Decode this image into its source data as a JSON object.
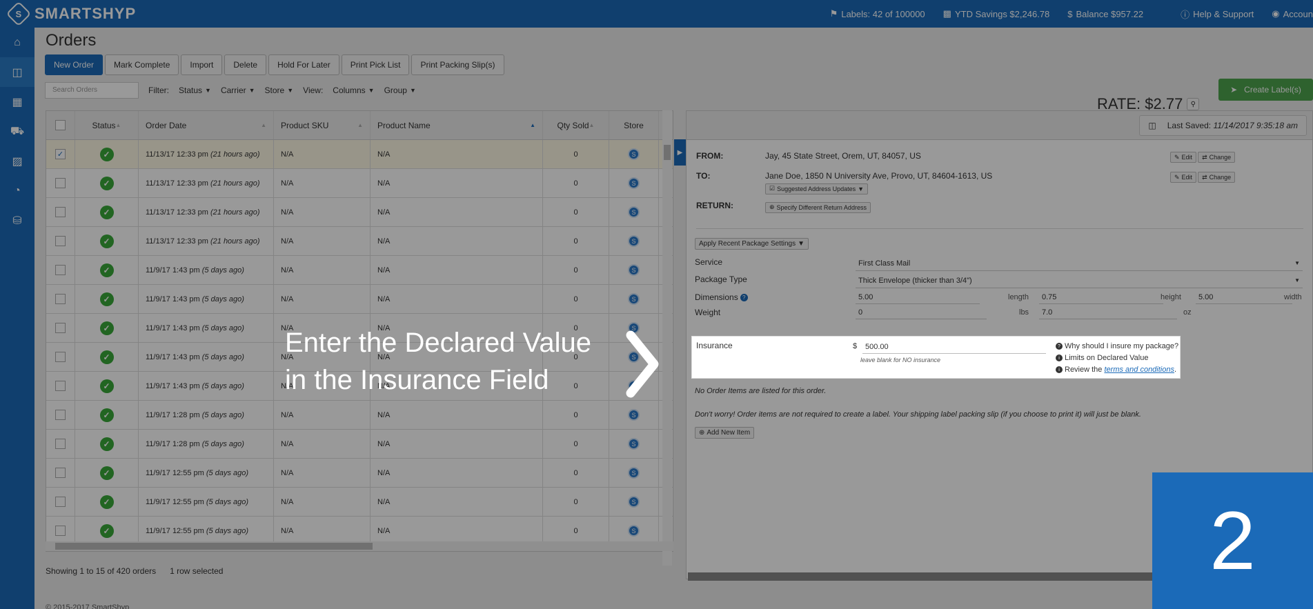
{
  "brand": {
    "logo_mark": "S",
    "name": "SMARTSHYP"
  },
  "topnav": {
    "labels": "Labels: 42 of 100000",
    "ytd": "YTD Savings $2,246.78",
    "balance": "Balance $957.22",
    "help": "Help & Support",
    "account": "Accoun"
  },
  "sidebar_icons": [
    "home-icon",
    "basket-icon",
    "calendar-icon",
    "truck-icon",
    "contacts-icon",
    "pie-chart-icon",
    "cart-icon"
  ],
  "page": {
    "title": "Orders"
  },
  "toolbar": {
    "new_order": "New Order",
    "mark_complete": "Mark Complete",
    "import": "Import",
    "delete": "Delete",
    "hold": "Hold For Later",
    "pick_list": "Print Pick List",
    "packing_slips": "Print Packing Slip(s)"
  },
  "filters": {
    "search_placeholder": "Search Orders",
    "filter_label": "Filter:",
    "status": "Status",
    "carrier": "Carrier",
    "store": "Store",
    "view_label": "View:",
    "columns": "Columns",
    "group": "Group"
  },
  "table": {
    "headers": [
      "Status",
      "Order Date",
      "Product SKU",
      "Product Name",
      "Qty Sold",
      "Store"
    ],
    "rows": [
      {
        "date": "11/13/17 12:33 pm",
        "ago": "(21 hours ago)",
        "sku": "N/A",
        "name": "N/A",
        "qty": "0"
      },
      {
        "date": "11/13/17 12:33 pm",
        "ago": "(21 hours ago)",
        "sku": "N/A",
        "name": "N/A",
        "qty": "0"
      },
      {
        "date": "11/13/17 12:33 pm",
        "ago": "(21 hours ago)",
        "sku": "N/A",
        "name": "N/A",
        "qty": "0"
      },
      {
        "date": "11/13/17 12:33 pm",
        "ago": "(21 hours ago)",
        "sku": "N/A",
        "name": "N/A",
        "qty": "0"
      },
      {
        "date": "11/9/17 1:43 pm",
        "ago": "(5 days ago)",
        "sku": "N/A",
        "name": "N/A",
        "qty": "0"
      },
      {
        "date": "11/9/17 1:43 pm",
        "ago": "(5 days ago)",
        "sku": "N/A",
        "name": "N/A",
        "qty": "0"
      },
      {
        "date": "11/9/17 1:43 pm",
        "ago": "(5 days ago)",
        "sku": "N/A",
        "name": "N/A",
        "qty": "0"
      },
      {
        "date": "11/9/17 1:43 pm",
        "ago": "(5 days ago)",
        "sku": "N/A",
        "name": "N/A",
        "qty": "0"
      },
      {
        "date": "11/9/17 1:43 pm",
        "ago": "(5 days ago)",
        "sku": "N/A",
        "name": "N/A",
        "qty": "0"
      },
      {
        "date": "11/9/17 1:28 pm",
        "ago": "(5 days ago)",
        "sku": "N/A",
        "name": "N/A",
        "qty": "0"
      },
      {
        "date": "11/9/17 1:28 pm",
        "ago": "(5 days ago)",
        "sku": "N/A",
        "name": "N/A",
        "qty": "0"
      },
      {
        "date": "11/9/17 12:55 pm",
        "ago": "(5 days ago)",
        "sku": "N/A",
        "name": "N/A",
        "qty": "0"
      },
      {
        "date": "11/9/17 12:55 pm",
        "ago": "(5 days ago)",
        "sku": "N/A",
        "name": "N/A",
        "qty": "0"
      },
      {
        "date": "11/9/17 12:55 pm",
        "ago": "(5 days ago)",
        "sku": "N/A",
        "name": "N/A",
        "qty": "0"
      }
    ],
    "footer_showing": "Showing 1 to 15 of 420 orders",
    "footer_selected": "1 row selected"
  },
  "copyright": "© 2015-2017 SmartShyp",
  "rate": {
    "label": "RATE: $2.77",
    "create_button": "Create Label(s)"
  },
  "panel": {
    "last_saved_label": "Last Saved:",
    "last_saved_value": "11/14/2017 9:35:18 am",
    "from_label": "FROM:",
    "from_value": "Jay, 45 State Street, Orem, UT, 84057, US",
    "to_label": "TO:",
    "to_value": "Jane Doe, 1850 N University Ave, Provo, UT, 84604-1613, US",
    "suggested": "Suggested Address Updates",
    "return_label": "RETURN:",
    "return_button": "Specify Different Return Address",
    "edit": "Edit",
    "change": "Change",
    "recent_pkg": "Apply Recent Package Settings",
    "service_label": "Service",
    "service_value": "First Class Mail",
    "package_label": "Package Type",
    "package_value": "Thick Envelope (thicker than 3/4\")",
    "dimensions_label": "Dimensions",
    "length": "5.00",
    "length_unit": "length",
    "height": "0.75",
    "height_unit": "height",
    "width": "5.00",
    "width_unit": "width",
    "weight_label": "Weight",
    "lbs": "0",
    "lbs_unit": "lbs",
    "oz": "7.0",
    "oz_unit": "oz",
    "insurance_label": "Insurance",
    "currency": "$",
    "insurance_value": "500.00",
    "insurance_hint": "leave blank for NO insurance",
    "why_insure": "Why should I insure my package?",
    "limits": "Limits on Declared Value",
    "review_prefix": "Review the",
    "terms": "terms and conditions",
    "review_suffix": ".",
    "no_items": "No Order Items are listed for this order.",
    "dont_worry": "Don't worry! Order items are not required to create a label. Your shipping label packing slip (if you choose to print it) will just be blank.",
    "add_item": "Add New Item"
  },
  "callout": {
    "line1": "Enter the Declared Value",
    "line2": "in the Insurance Field",
    "step": "2"
  }
}
